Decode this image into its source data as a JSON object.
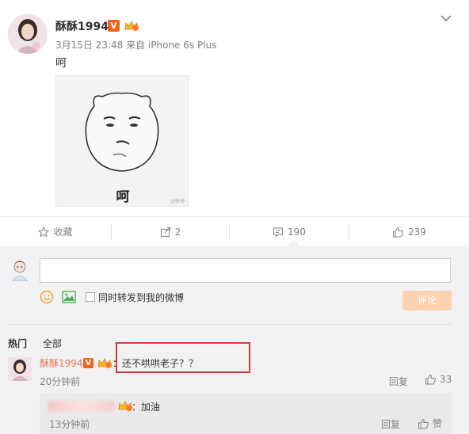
{
  "post": {
    "username": "酥酥1994",
    "verified_badge": "V",
    "meta": "3月15日 23:48 来自 iPhone 6s Plus",
    "text": "呵",
    "image_caption": "呵",
    "image_watermark": "@微博"
  },
  "actions": {
    "favorite_label": "收藏",
    "repost_count": "2",
    "comment_count": "190",
    "like_count": "239"
  },
  "composer": {
    "input_value": "",
    "repost_label": "同时转发到我的微博",
    "submit_label": "评论"
  },
  "tabs": {
    "hot": "热门",
    "all": "全部"
  },
  "comments": [
    {
      "username": "酥酥1994",
      "verified_badge": "V",
      "text": "：还不哄哄老子？？",
      "time": "20分钟前",
      "reply_label": "回复",
      "likes": "33"
    }
  ],
  "replies": [
    {
      "text": "：加油",
      "time": "13分钟前",
      "reply_label": "回复",
      "like_label": "赞"
    }
  ],
  "colors": {
    "accent": "#eb7350",
    "verified": "#f3621a",
    "highlight_box": "#d9363e",
    "submit_disabled": "#fdd2b0",
    "section_bg": "#f2f2f5"
  },
  "icons": [
    "chevron-down-icon",
    "star-icon",
    "repost-icon",
    "comment-icon",
    "thumbs-up-icon",
    "emoji-icon",
    "image-icon",
    "crown-badge-icon"
  ]
}
